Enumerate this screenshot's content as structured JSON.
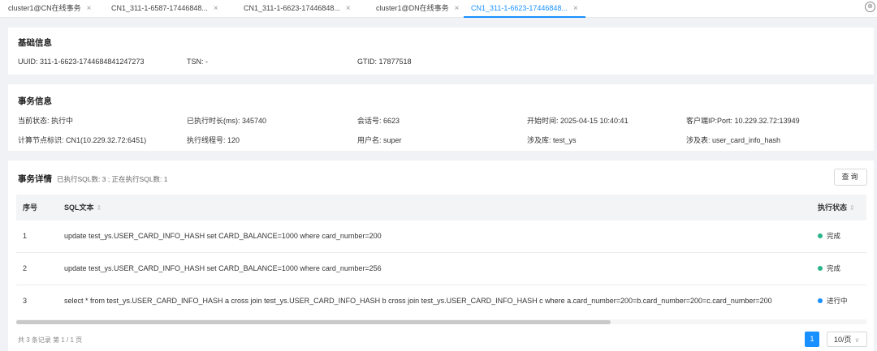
{
  "tabs": [
    {
      "label": "cluster1@CN在线事务",
      "close": "×"
    },
    {
      "label": "CN1_311-1-6587-17446848...",
      "close": "×"
    },
    {
      "label": "CN1_311-1-6623-17446848...",
      "close": "×"
    },
    {
      "label": "cluster1@DN在线事务",
      "close": "×"
    },
    {
      "label": "CN1_311-1-6623-17446848...",
      "close": "×"
    }
  ],
  "close_all_icon": "⊗",
  "basic": {
    "title": "基础信息",
    "uuid": "UUID: 311-1-6623-1744684841247273",
    "tsn": "TSN: -",
    "gtid": "GTID: 17877518"
  },
  "txn": {
    "title": "事务信息",
    "status": "当前状态: 执行中",
    "duration": "已执行时长(ms): 345740",
    "session": "会话号: 6623",
    "start_time": "开始时间: 2025-04-15 10:40:41",
    "client": "客户端IP:Port: 10.229.32.72:13949",
    "node": "计算节点标识: CN1(10.229.32.72:6451)",
    "thread": "执行线程号: 120",
    "user": "用户名: super",
    "database": "涉及库: test_ys",
    "table": "涉及表: user_card_info_hash"
  },
  "detail": {
    "title": "事务详情",
    "subtitle": "已执行SQL数: 3 ; 正在执行SQL数: 1",
    "query_button": "查询",
    "columns": {
      "seq": "序号",
      "sql": "SQL文本",
      "status": "执行状态"
    },
    "rows": [
      {
        "seq": "1",
        "sql": "update test_ys.USER_CARD_INFO_HASH set CARD_BALANCE=1000 where card_number=200",
        "status": "完成",
        "status_color": "#2bb38a"
      },
      {
        "seq": "2",
        "sql": "update test_ys.USER_CARD_INFO_HASH set CARD_BALANCE=1000 where card_number=256",
        "status": "完成",
        "status_color": "#2bb38a"
      },
      {
        "seq": "3",
        "sql": "select * from test_ys.USER_CARD_INFO_HASH a cross join test_ys.USER_CARD_INFO_HASH b cross join test_ys.USER_CARD_INFO_HASH c where a.card_number=200=b.card_number=200=c.card_number=200",
        "status": "进行中",
        "status_color": "#1890ff"
      }
    ],
    "total": "共 3 条记录  第 1 / 1 页",
    "page": "1",
    "page_size": "10/页"
  },
  "colors": {
    "accent": "#1890ff",
    "done": "#2bb38a"
  }
}
